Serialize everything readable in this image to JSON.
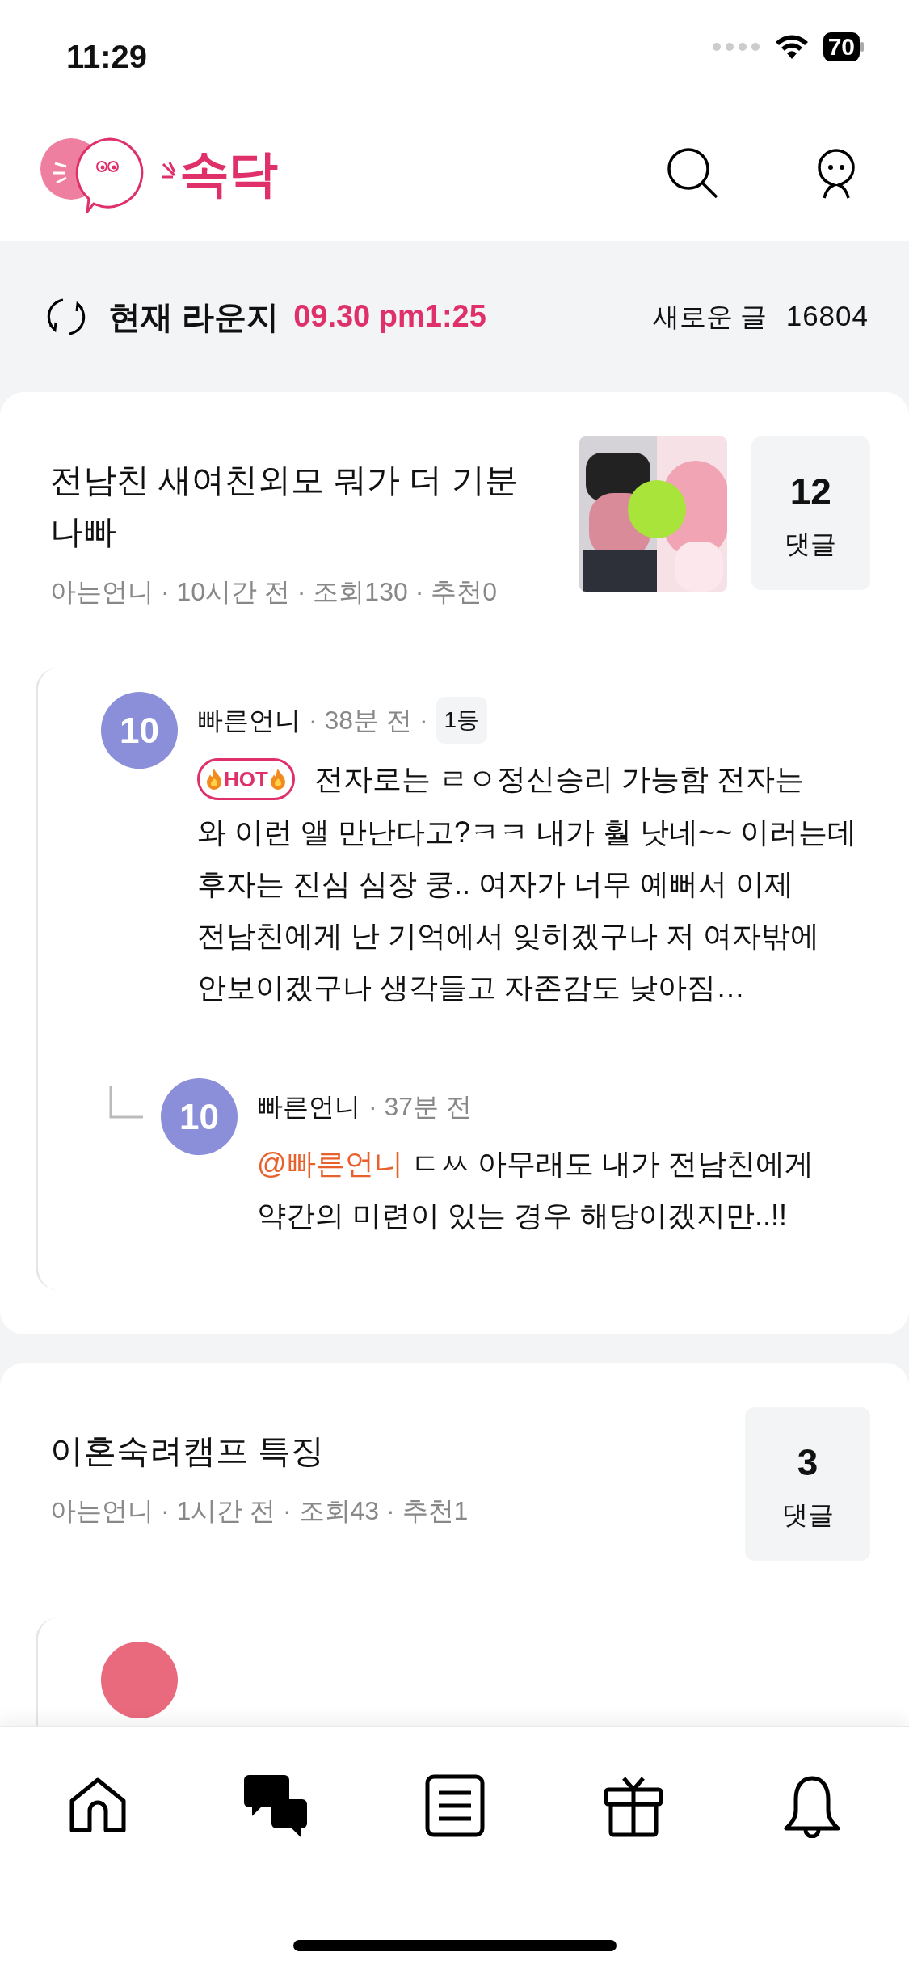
{
  "status_bar": {
    "time": "11:29",
    "battery": "70"
  },
  "header": {
    "logo_text": "속닥"
  },
  "lounge": {
    "title": "현재 라운지",
    "timestamp": "09.30 pm1:25",
    "new_label": "새로운 글",
    "new_count": "16804"
  },
  "posts": [
    {
      "title": "전남친 새여친외모 뭐가 더 기분 나빠",
      "meta": "아는언니 · 10시간 전 · 조회130 · 추천0",
      "thumbnail": {
        "kind": "picture"
      },
      "comment_count": "12",
      "comment_label": "댓글",
      "comments": [
        {
          "kind": "full",
          "badge": "10",
          "color": "#8b8fd9",
          "author": "빠른언니",
          "time": "· 38분 전 ·",
          "rank": "1등",
          "hot": true,
          "hot_label": "HOT",
          "first_line": "전자로는 ㄹㅇ정신승리 가능함 전자는",
          "text": "와 이런 앨 만난다고?ㅋㅋ 내가 훨 낫네~~  이러는데 후자는 진심 심장 쿵.. 여자가 너무 예뻐서 이제 전남친에게 난 기억에서 잊히겠구나 저 여자밖에 안보이겠구나 생각들고 자존감도 낮아짐…",
          "replies": [
            {
              "badge": "10",
              "color": "#8b8fd9",
              "author": "빠른언니",
              "time": "· 37분 전",
              "mention": "@빠른언니",
              "text": "ㄷㅆ 아무래도 내가 전남친에게 약간의 미련이 있는 경우 해당이겠지만..!!"
            }
          ]
        }
      ]
    },
    {
      "title": "이혼숙려캠프 특징",
      "meta": "아는언니 · 1시간 전 · 조회43 · 추천1",
      "comment_count": "3",
      "comment_label": "댓글",
      "comments": [
        {
          "kind": "cut",
          "color": "#e96a7c"
        }
      ]
    }
  ],
  "tab_bar": [
    {
      "kind": "home",
      "selected": false
    },
    {
      "kind": "chat",
      "selected": true
    },
    {
      "kind": "list",
      "selected": false
    },
    {
      "kind": "gift",
      "selected": false
    },
    {
      "kind": "bell",
      "selected": false
    }
  ]
}
